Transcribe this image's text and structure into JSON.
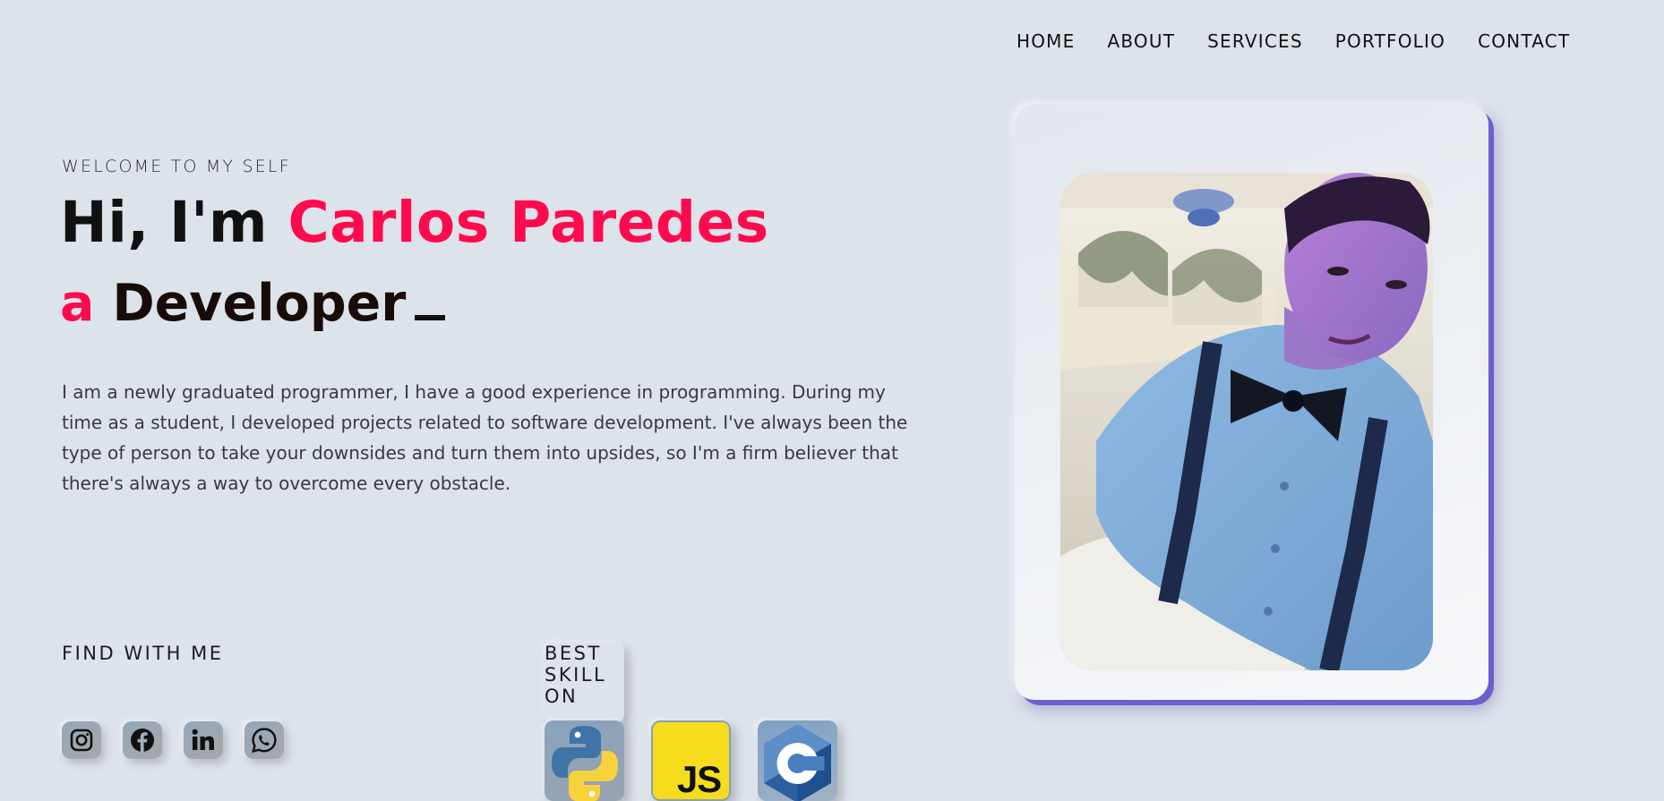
{
  "nav": {
    "items": [
      {
        "label": "HOME"
      },
      {
        "label": "ABOUT"
      },
      {
        "label": "SERVICES"
      },
      {
        "label": "PORTFOLIO"
      },
      {
        "label": "CONTACT"
      }
    ]
  },
  "hero": {
    "welcome": "WELCOME TO MY SELF",
    "greeting": "Hi, I'm ",
    "name": "Carlos Paredes",
    "role_article": "a",
    "role": "Developer",
    "bio": "I am a newly graduated programmer, I have a good experience in programming. During my time as a student, I developed projects related to software development. I've always been the type of person to take your downsides and turn them into upsides, so I'm a firm believer that there's always a way to overcome every obstacle."
  },
  "find": {
    "label": "FIND WITH ME",
    "socials": [
      "instagram-icon",
      "facebook-icon",
      "linkedin-icon",
      "whatsapp-icon"
    ]
  },
  "skills": {
    "label": "BEST SKILL ON",
    "items": [
      "python-icon",
      "javascript-icon",
      "c-lang-icon"
    ],
    "js_text": "JS"
  },
  "colors": {
    "accent": "#ff0a4f",
    "background": "#dde3ea",
    "card_shadow": "#6d5fcf"
  }
}
